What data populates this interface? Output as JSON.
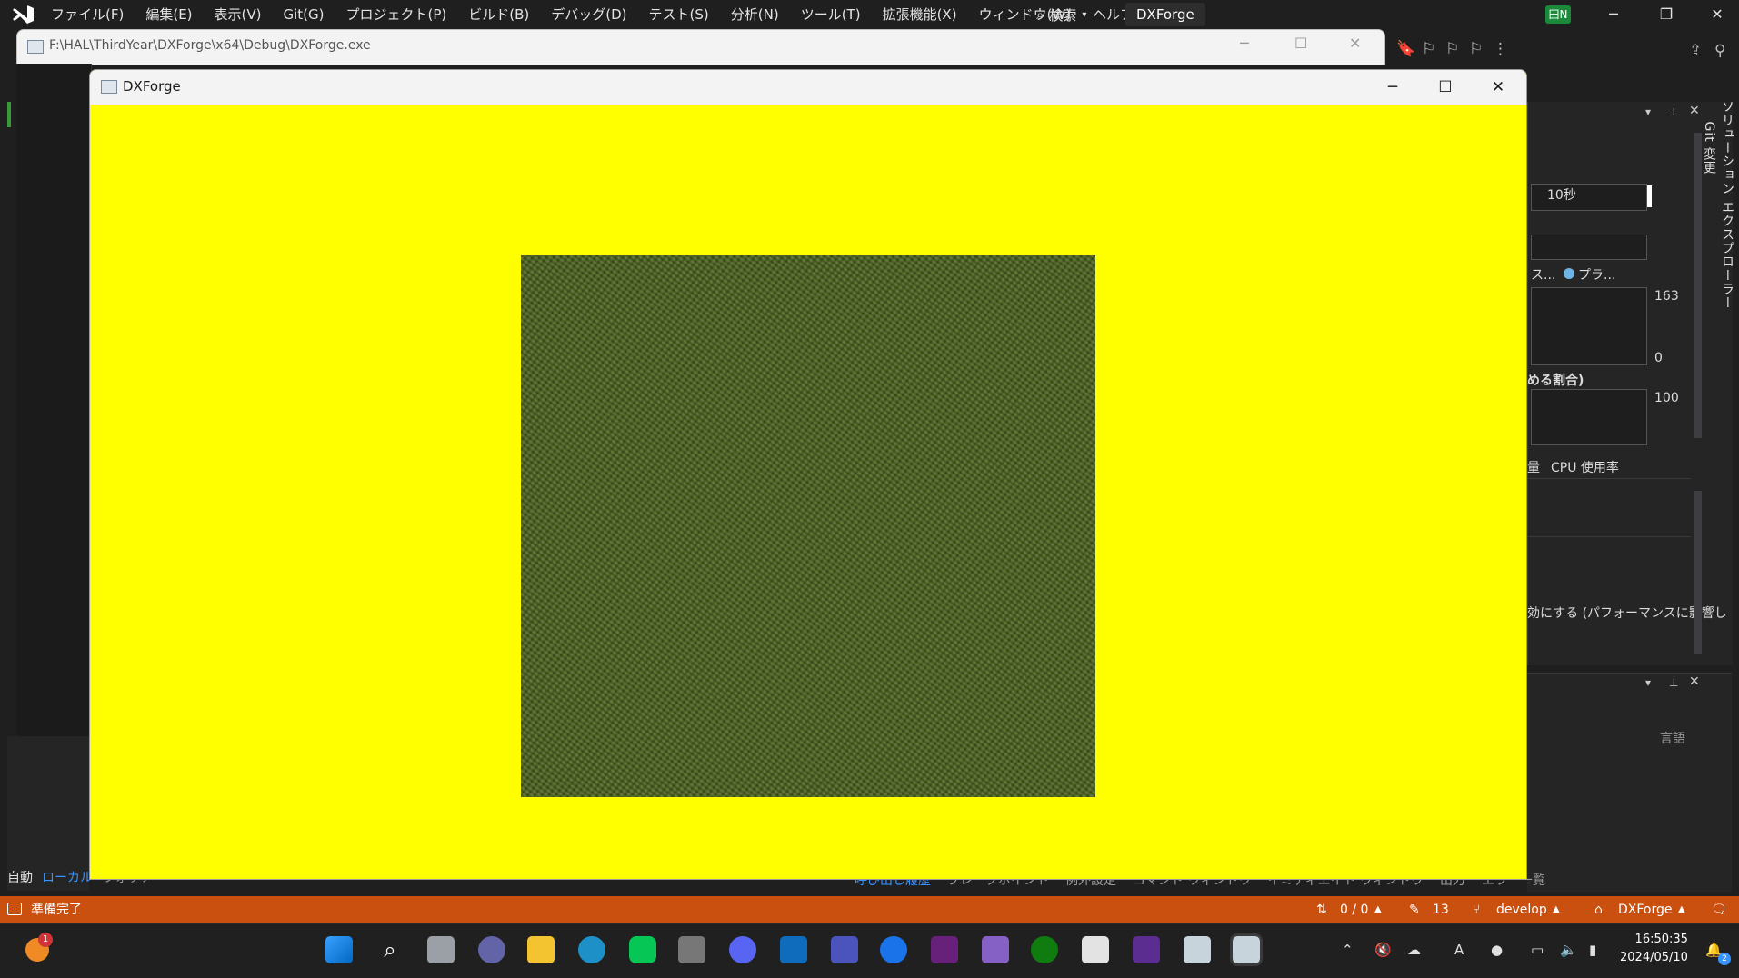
{
  "vs": {
    "menu": [
      "ファイル(F)",
      "編集(E)",
      "表示(V)",
      "Git(G)",
      "プロジェクト(P)",
      "ビルド(B)",
      "デバッグ(D)",
      "テスト(S)",
      "分析(N)",
      "ツール(T)",
      "拡張機能(X)",
      "ウィンドウ(W)",
      "ヘルプ(H)"
    ],
    "search_label": "検索",
    "solution_name": "DXForge",
    "ime_indicator": "田N"
  },
  "console_window": {
    "title": "F:\\HAL\\ThirdYear\\DXForge\\x64\\Debug\\DXForge.exe"
  },
  "dx_window": {
    "title": "DXForge",
    "background_color": "#ffff00"
  },
  "diagnostics": {
    "time_label": "10秒",
    "legend_left": "ス...",
    "legend_right": "プラ...",
    "mem_max": "163",
    "mem_min": "0",
    "cpu_heading": "める割合)",
    "cpu_max": "100",
    "tab_mem": "量",
    "tab_cpu": "CPU 使用率",
    "setting_text": "効にする (パフォーマンスに影響し",
    "lang_header": "言語"
  },
  "solution_explorer_tab": "ソリューション エクスプローラー",
  "git_changes_tab": "Git 変更",
  "debug_tabs": [
    "自動",
    "ローカル",
    "ウォッチ"
  ],
  "bottom_tabs": [
    "呼び出し履歴",
    "ブレークポイント",
    "例外設定",
    "コマンド ウィンドウ",
    "イミディエイト ウィンドウ",
    "出力",
    "エラー一覧"
  ],
  "statusbar": {
    "ready": "準備完了",
    "updown": "0 / 0",
    "changes": "13",
    "branch": "develop",
    "repo": "DXForge"
  },
  "taskbar": {
    "notification_count": "1",
    "time": "16:50:35",
    "date": "2024/05/10",
    "ime": "A",
    "bell_count": "2"
  }
}
